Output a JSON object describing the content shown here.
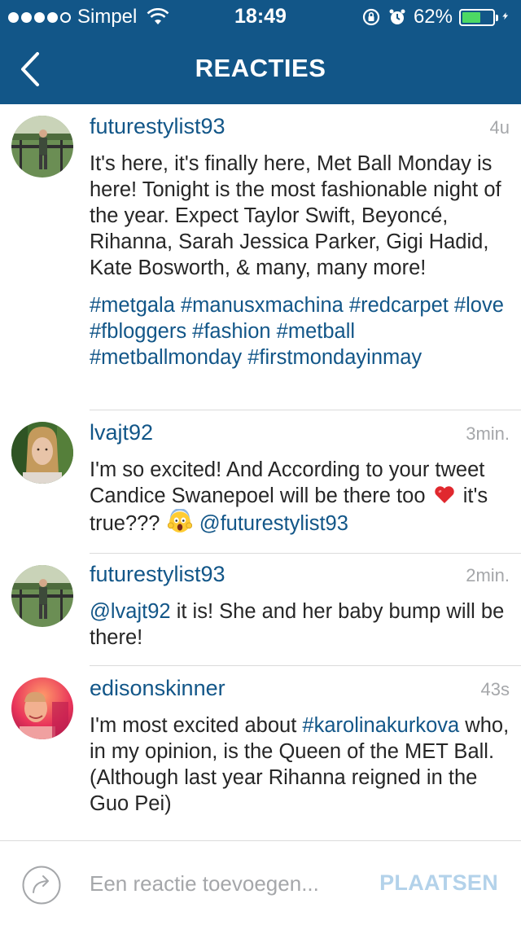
{
  "status_bar": {
    "carrier": "Simpel",
    "time": "18:49",
    "battery": "62%",
    "battery_level": 0.62,
    "battery_color": "#4cd964"
  },
  "header": {
    "title": "REACTIES",
    "background_color": "#125688",
    "back_icon": "chevron-left-icon"
  },
  "comments": [
    {
      "username": "futurestylist93",
      "time": "4u",
      "text": "It's here, it's finally here, Met Ball Monday is here! Tonight is the most fashionable night of the year. Expect Taylor Swift, Beyoncé, Rihanna, Sarah Jessica Parker, Gigi Hadid, Kate Bosworth, & many, many more!",
      "hashtags": "#metgala #manusxmachina #redcarpet #love #fbloggers #fashion #metball #metballmonday #firstmondayinmay"
    },
    {
      "username": "lvajt92",
      "time": "3min.",
      "text_before": "I'm so excited! And According to your tweet Candice Swanepoel will be there too",
      "text_middle": "it's true???",
      "mention": "@futurestylist93",
      "emoji_1": "red-heart",
      "emoji_2": "face-screaming-in-fear"
    },
    {
      "username": "futurestylist93",
      "time": "2min.",
      "mention": "@lvajt92",
      "text": "it is! She and her baby bump will be there!"
    },
    {
      "username": "edisonskinner",
      "time": "43s",
      "text_before": "I'm most excited about",
      "hashtag": "#karolinakurkova",
      "text_after": "who, in my opinion, is the Queen of the MET Ball. (Although last year Rihanna reigned in the Guo Pei)"
    }
  ],
  "composer": {
    "placeholder": "Een reactie toevoegen...",
    "post_label": "PLAATSEN",
    "icon": "share-arrow-icon"
  },
  "colors": {
    "link": "#125688",
    "timestamp": "#a5a7aa",
    "post_disabled": "#b3d2ea"
  }
}
